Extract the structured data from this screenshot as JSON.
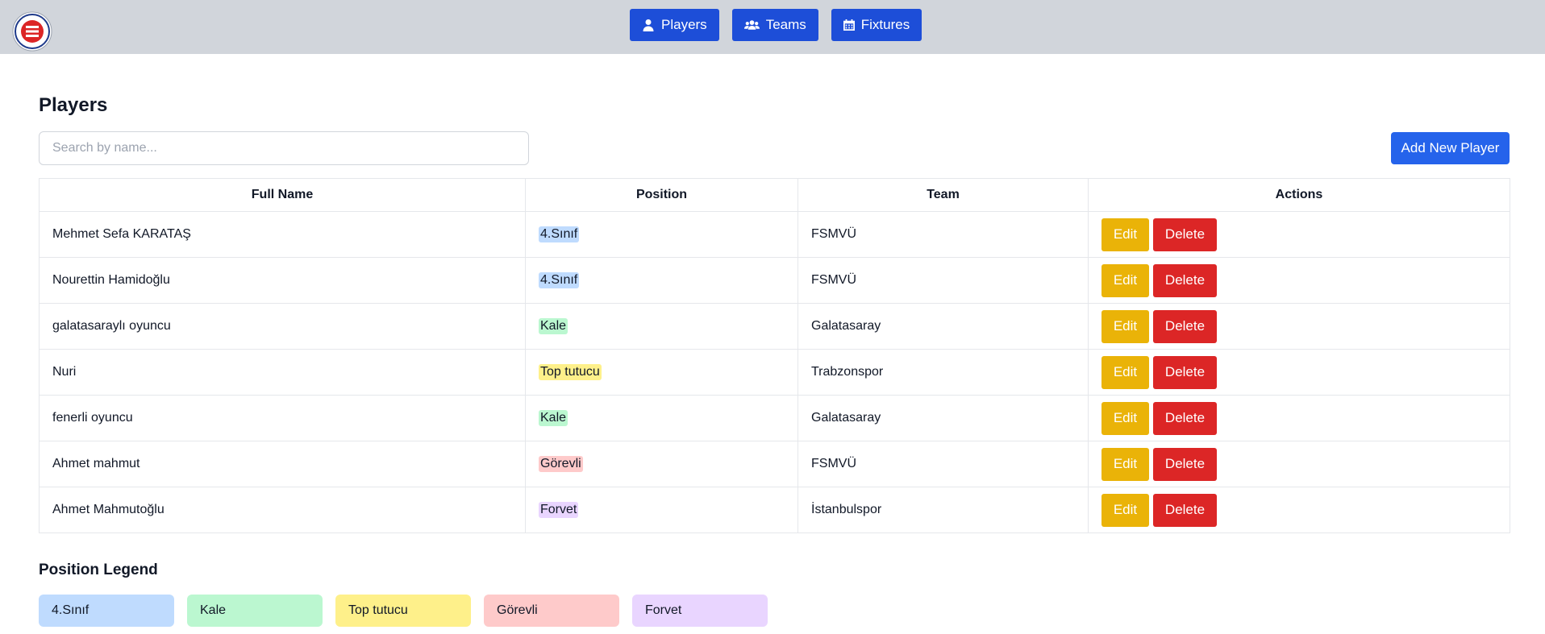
{
  "header": {
    "nav": [
      {
        "label": "Players",
        "icon": "user-icon"
      },
      {
        "label": "Teams",
        "icon": "users-icon"
      },
      {
        "label": "Fixtures",
        "icon": "calendar-icon"
      }
    ]
  },
  "main": {
    "title": "Players",
    "search_placeholder": "Search by name...",
    "add_label": "Add New Player",
    "columns": [
      "Full Name",
      "Position",
      "Team",
      "Actions"
    ],
    "edit_label": "Edit",
    "delete_label": "Delete",
    "rows": [
      {
        "name": "Mehmet Sefa KARATAŞ",
        "position": "4.Sınıf",
        "team": "FSMVÜ"
      },
      {
        "name": "Nourettin Hamidoğlu",
        "position": "4.Sınıf",
        "team": "FSMVÜ"
      },
      {
        "name": "galatasaraylı oyuncu",
        "position": "Kale",
        "team": "Galatasaray"
      },
      {
        "name": "Nuri",
        "position": "Top tutucu",
        "team": "Trabzonspor"
      },
      {
        "name": "fenerli oyuncu",
        "position": "Kale",
        "team": "Galatasaray"
      },
      {
        "name": "Ahmet mahmut",
        "position": "Görevli",
        "team": "FSMVÜ"
      },
      {
        "name": "Ahmet Mahmutoğlu",
        "position": "Forvet",
        "team": "İstanbulspor"
      }
    ]
  },
  "legend": {
    "title": "Position Legend",
    "items": [
      "4.Sınıf",
      "Kale",
      "Top tutucu",
      "Görevli",
      "Forvet"
    ]
  },
  "colors": {
    "4.Sınıf": "#bfdbfe",
    "Kale": "#bbf7d0",
    "Top tutucu": "#fef08a",
    "Görevli": "#fecaca",
    "Forvet": "#e9d5ff",
    "nav_bg": "#1d4ed8",
    "add_button": "#2563eb",
    "edit_button": "#eab308",
    "delete_button": "#dc2626",
    "topbar": "#d1d5db"
  }
}
